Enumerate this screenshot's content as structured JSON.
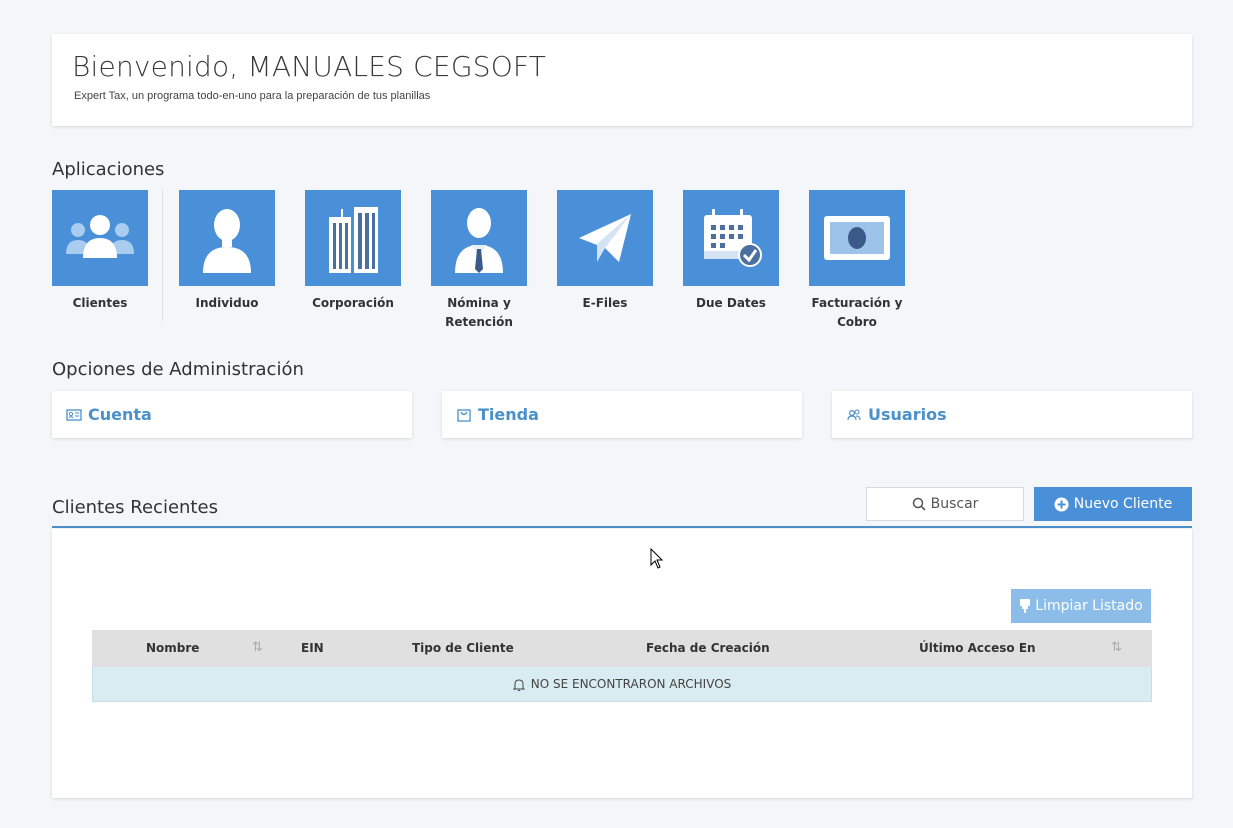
{
  "welcome": {
    "title": "Bienvenido, MANUALES CEGSOFT",
    "subtitle": "Expert Tax, un programa todo-en-uno para la preparación de tus planillas"
  },
  "apps": {
    "title": "Aplicaciones",
    "items": [
      {
        "label": "Clientes",
        "icon": "users-icon"
      },
      {
        "label": "Individuo",
        "icon": "person-icon"
      },
      {
        "label": "Corporación",
        "icon": "buildings-icon"
      },
      {
        "label": "Nómina y Retención",
        "icon": "employee-tie-icon"
      },
      {
        "label": "E-Files",
        "icon": "paper-plane-icon"
      },
      {
        "label": "Due Dates",
        "icon": "calendar-check-icon"
      },
      {
        "label": "Facturación y Cobro",
        "icon": "banknote-icon"
      }
    ]
  },
  "admin": {
    "title": "Opciones de Administración",
    "items": [
      {
        "label": "Cuenta",
        "icon": "id-card-icon"
      },
      {
        "label": "Tienda",
        "icon": "shopping-bag-icon"
      },
      {
        "label": "Usuarios",
        "icon": "users-outline-icon"
      }
    ]
  },
  "recent": {
    "title": "Clientes Recientes",
    "search_label": "Buscar",
    "new_label": "Nuevo Cliente",
    "clear_label": "Limpiar Listado",
    "columns": [
      "Nombre",
      "EIN",
      "Tipo de Cliente",
      "Fecha de Creación",
      "Último Acceso En"
    ],
    "empty_message": "NO SE ENCONTRARON ARCHIVOS"
  },
  "colors": {
    "accent": "#4a90d9",
    "link": "#4a90c9",
    "clear_button": "#8bbde8",
    "empty_row": "#d9ecf2"
  }
}
